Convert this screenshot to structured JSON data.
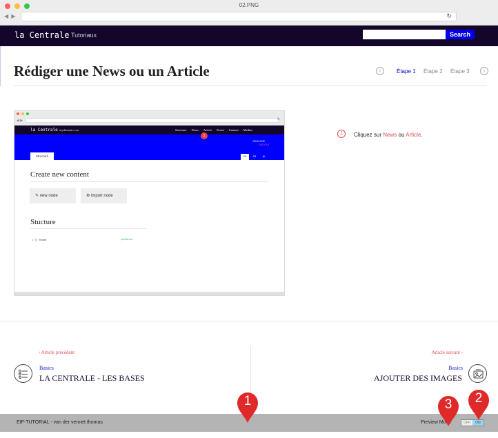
{
  "window": {
    "title": "02.PNG",
    "nav_arrows": "◀ ▶",
    "reload": "↻"
  },
  "topnav": {
    "brand": "la Centrale",
    "link": "Tutoriaux",
    "search_label": "Search",
    "search_placeholder": ""
  },
  "page": {
    "title": "Rédiger une News ou un Article"
  },
  "steps": {
    "prev": "‹",
    "next": "›",
    "items": [
      "Étape 1",
      "Étape 2",
      "Étape 3"
    ],
    "active_index": 0
  },
  "screenshot": {
    "brand": "la Centrale",
    "domain": "mydomain.com",
    "menu": [
      "Structure",
      "News",
      "Article",
      "Event",
      "Contact",
      "Medias"
    ],
    "marker": "1",
    "user": "JOHN DOE",
    "user_sub": "LOG OUT",
    "tab": "Structure",
    "langs": [
      "EN",
      "FR",
      "NL"
    ],
    "heading1": "Create new content",
    "btn_new": "new node",
    "btn_import": "import node",
    "heading2": "Stucture",
    "item": "Home",
    "status": "published"
  },
  "instruction": {
    "num": "1",
    "before": "Cliquez sur ",
    "news": "News",
    "mid": " ou ",
    "article": "Article",
    "after": "."
  },
  "prev": {
    "label": "‹ Article précédent",
    "category": "Basics",
    "title": "LA CENTRALE - LES BASES"
  },
  "next": {
    "label": "Article suivant ›",
    "category": "Basics",
    "title": "AJOUTER DES IMAGES"
  },
  "footer": {
    "text": "EIF-TUTORIAL  -  van der vennet thomas",
    "preview": "Preview Mode",
    "off": "OFF",
    "on": "ON"
  },
  "pins": [
    "1",
    "2",
    "3"
  ],
  "colors": {
    "nav": "#14062a",
    "accent": "#e84c52",
    "link": "#0000ee",
    "blue": "#0000ff",
    "pin": "#e02a2a"
  }
}
